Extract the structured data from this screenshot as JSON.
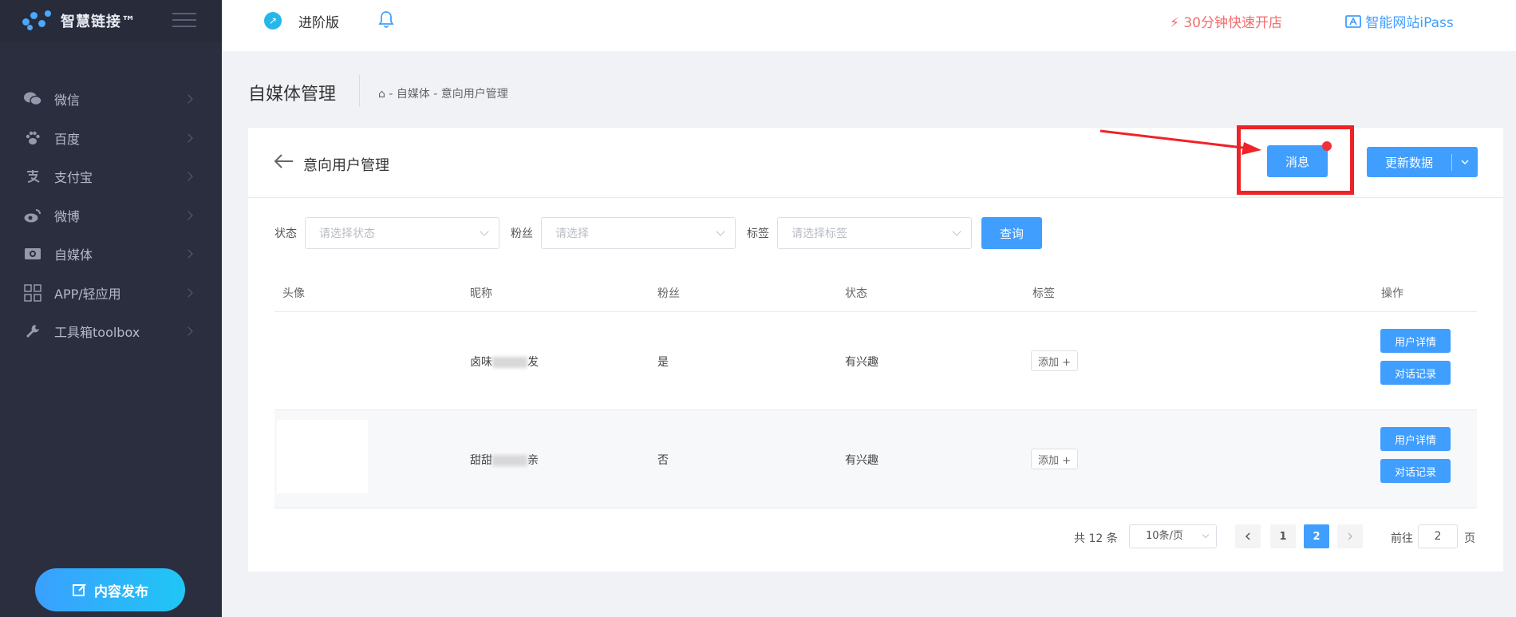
{
  "sidebar": {
    "brand": "智慧链接™",
    "items": [
      {
        "label": "微信",
        "icon": "wechat-icon"
      },
      {
        "label": "百度",
        "icon": "baidu-paw-icon"
      },
      {
        "label": "支付宝",
        "icon": "alipay-icon"
      },
      {
        "label": "微博",
        "icon": "weibo-icon"
      },
      {
        "label": "自媒体",
        "icon": "media-icon"
      },
      {
        "label": "APP/轻应用",
        "icon": "app-grid-icon"
      },
      {
        "label": "工具箱toolbox",
        "icon": "wrench-icon"
      }
    ],
    "publish_label": "内容发布"
  },
  "topbar": {
    "plan": "进阶版",
    "quick_open": "30分钟快速开店",
    "ipass": "智能网站iPass"
  },
  "page": {
    "title": "自媒体管理",
    "breadcrumb": "⌂ - 自媒体 - 意向用户管理"
  },
  "card": {
    "title": "意向用户管理",
    "message_btn": "消息",
    "update_btn": "更新数据"
  },
  "filters": {
    "status_label": "状态",
    "status_placeholder": "请选择状态",
    "fans_label": "粉丝",
    "fans_placeholder": "请选择",
    "tag_label": "标签",
    "tag_placeholder": "请选择标签",
    "query_btn": "查询"
  },
  "table": {
    "columns": [
      "头像",
      "昵称",
      "粉丝",
      "状态",
      "标签",
      "操作"
    ],
    "rows": [
      {
        "nick_start": "卤味",
        "nick_end": "发",
        "fans": "是",
        "status": "有兴趣",
        "tag_btn": "添加 +",
        "detail_btn": "用户详情",
        "chat_btn": "对话记录"
      },
      {
        "nick_start": "甜甜",
        "nick_end": "亲",
        "fans": "否",
        "status": "有兴趣",
        "tag_btn": "添加 +",
        "detail_btn": "用户详情",
        "chat_btn": "对话记录"
      }
    ]
  },
  "pagination": {
    "total": "共 12 条",
    "page_size": "10条/页",
    "pages": [
      "1",
      "2"
    ],
    "current": "2",
    "goto_label": "前往",
    "goto_value": "2",
    "unit": "页"
  },
  "colors": {
    "accent": "#409eff",
    "sidebar_bg": "#2b2e3f",
    "highlight_red": "#ef2227"
  }
}
